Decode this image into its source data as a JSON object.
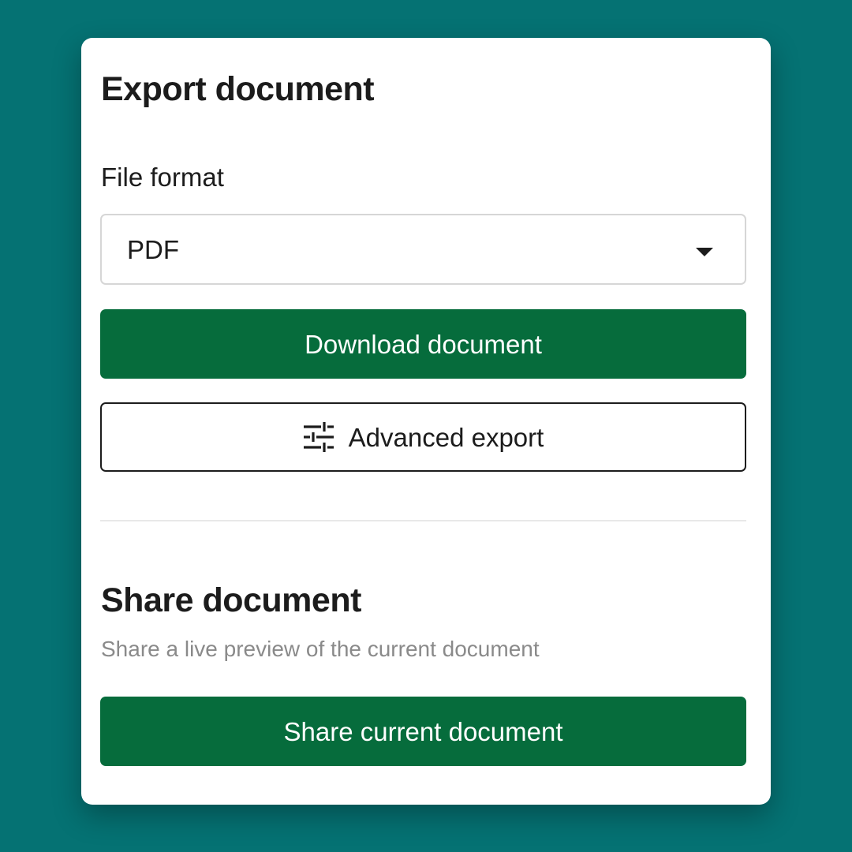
{
  "export": {
    "title": "Export document",
    "file_format_label": "File format",
    "file_format_value": "PDF",
    "download_label": "Download document",
    "advanced_label": "Advanced export"
  },
  "share": {
    "title": "Share document",
    "subtitle": "Share a live preview of the current document",
    "share_label": "Share current document"
  },
  "icons": {
    "select_caret": "chevron-down-icon",
    "advanced": "tune-sliders-icon"
  },
  "colors": {
    "background": "#057273",
    "primary_button": "#066c3c",
    "panel": "#ffffff"
  }
}
